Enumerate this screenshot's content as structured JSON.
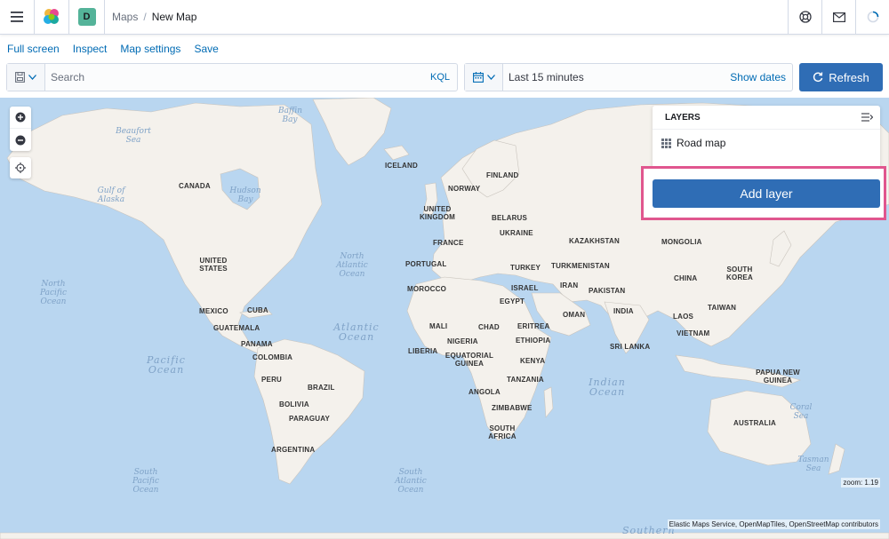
{
  "header": {
    "breadcrumbs": [
      "Maps",
      "New Map"
    ],
    "space_initial": "D"
  },
  "menu": {
    "items": [
      "Full screen",
      "Inspect",
      "Map settings",
      "Save"
    ]
  },
  "query": {
    "search_placeholder": "Search",
    "language": "KQL",
    "time_range": "Last 15 minutes",
    "show_dates_label": "Show dates",
    "refresh_label": "Refresh"
  },
  "layers_panel": {
    "title": "LAYERS",
    "layers": [
      {
        "name": "Road map"
      }
    ],
    "add_layer_label": "Add layer"
  },
  "map": {
    "zoom_label": "zoom: 1.19",
    "attribution": "Elastic Maps Service, OpenMapTiles, OpenStreetMap contributors",
    "countries": [
      "ICELAND",
      "FINLAND",
      "NORWAY",
      "CANADA",
      "UNITED KINGDOM",
      "BELARUS",
      "UKRAINE",
      "FRANCE",
      "KAZAKHSTAN",
      "MONGOLIA",
      "PORTUGAL",
      "TURKEY",
      "TURKMENISTAN",
      "SOUTH KOREA",
      "UNITED STATES",
      "MOROCCO",
      "ISRAEL",
      "IRAN",
      "PAKISTAN",
      "CHINA",
      "EGYPT",
      "MEXICO",
      "CUBA",
      "INDIA",
      "OMAN",
      "TAIWAN",
      "GUATEMALA",
      "LAOS",
      "MALI",
      "CHAD",
      "ERITREA",
      "VIETNAM",
      "PANAMA",
      "NIGERIA",
      "ETHIOPIA",
      "LIBERIA",
      "SRI LANKA",
      "COLOMBIA",
      "EQUATORIAL GUINEA",
      "KENYA",
      "PAPUA NEW GUINEA",
      "PERU",
      "BRAZIL",
      "TANZANIA",
      "ANGOLA",
      "BOLIVIA",
      "ZIMBABWE",
      "PARAGUAY",
      "AUSTRALIA",
      "SOUTH AFRICA",
      "ARGENTINA"
    ],
    "oceans": [
      "Baffin Bay",
      "Beaufort Sea",
      "Gulf of Alaska",
      "Hudson Bay",
      "North Atlantic Ocean",
      "North Pacific Ocean",
      "Atlantic Ocean",
      "Pacific Ocean",
      "Indian Ocean",
      "Coral Sea",
      "Tasman Sea",
      "South Pacific Ocean",
      "South Atlantic Ocean",
      "Southern"
    ]
  }
}
